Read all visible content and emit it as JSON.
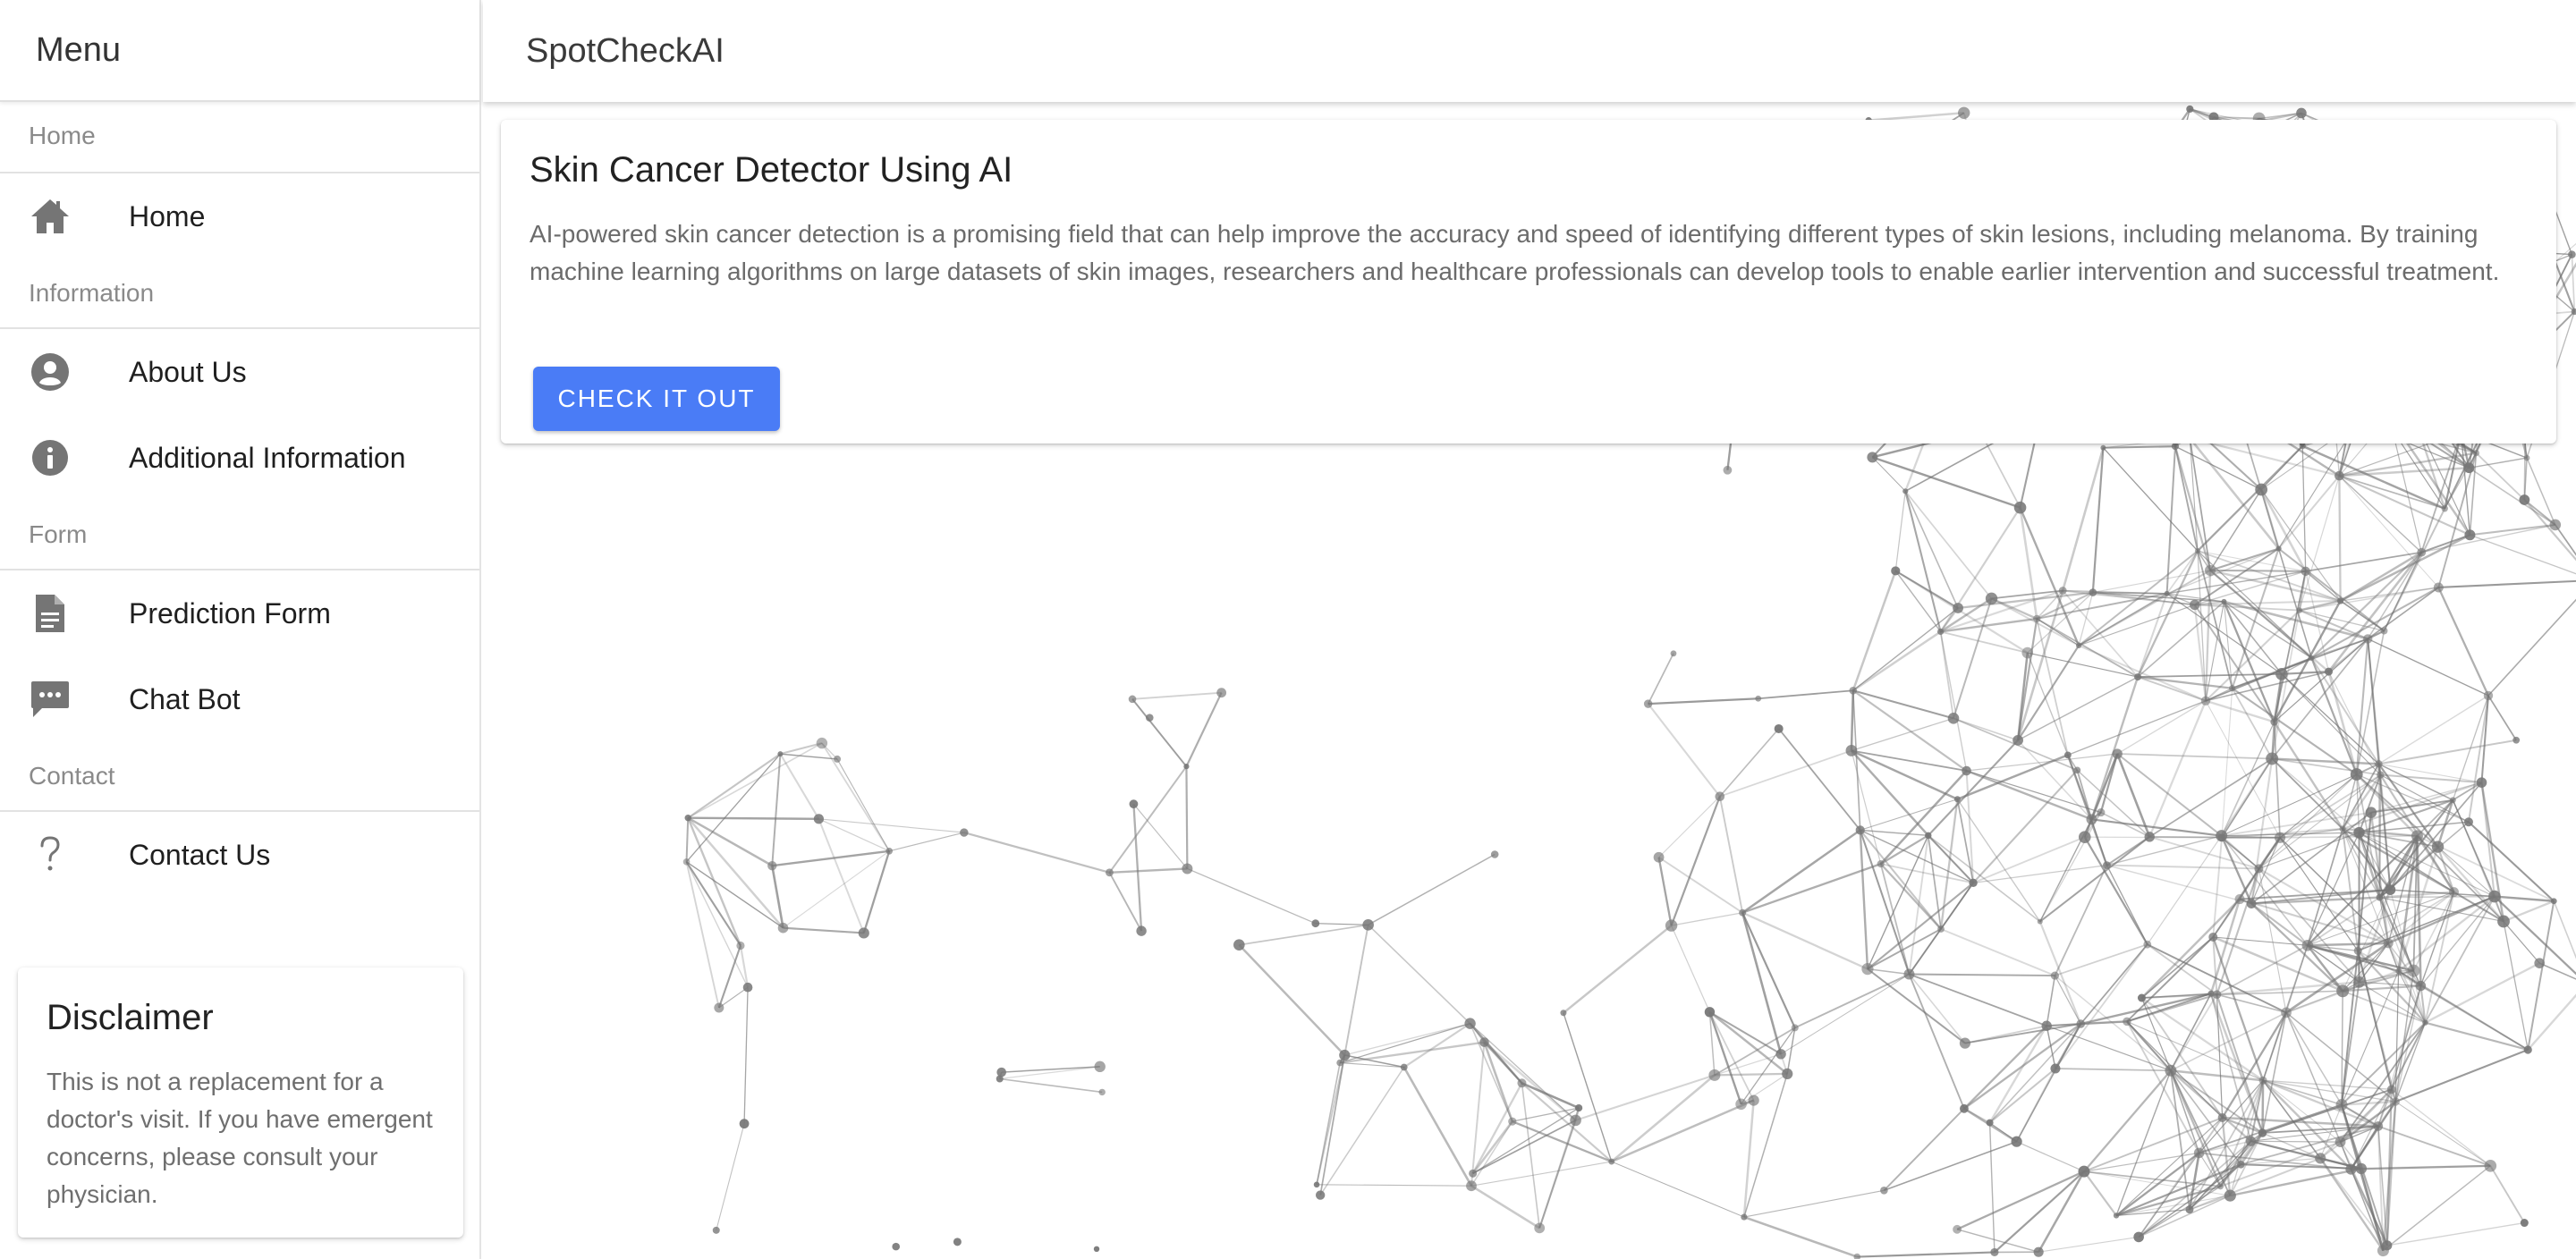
{
  "sidebar": {
    "title": "Menu",
    "sections": [
      {
        "label": "Home",
        "items": [
          {
            "label": "Home",
            "icon": "home-icon"
          }
        ]
      },
      {
        "label": "Information",
        "items": [
          {
            "label": "About Us",
            "icon": "account-circle-icon"
          },
          {
            "label": "Additional Information",
            "icon": "info-icon"
          }
        ]
      },
      {
        "label": "Form",
        "items": [
          {
            "label": "Prediction Form",
            "icon": "document-icon"
          },
          {
            "label": "Chat Bot",
            "icon": "chat-icon"
          }
        ]
      },
      {
        "label": "Contact",
        "items": [
          {
            "label": "Contact Us",
            "icon": "question-mark-icon"
          }
        ]
      }
    ],
    "disclaimer": {
      "title": "Disclaimer",
      "text": "This is not a replacement for a doctor's visit. If you have emergent concerns, please consult your physician."
    }
  },
  "appbar": {
    "title": "SpotCheckAI"
  },
  "main": {
    "card": {
      "title": "Skin Cancer Detector Using AI",
      "text": "AI-powered skin cancer detection is a promising field that can help improve the accuracy and speed of identifying different types of skin lesions, including melanoma. By training machine learning algorithms on large datasets of skin images, researchers and healthcare professionals can develop tools to enable earlier intervention and successful treatment.",
      "button_label": "CHECK IT OUT"
    }
  },
  "colors": {
    "accent": "#4a7cf6",
    "icon": "#757575",
    "muted_text": "#6b6b6b"
  }
}
